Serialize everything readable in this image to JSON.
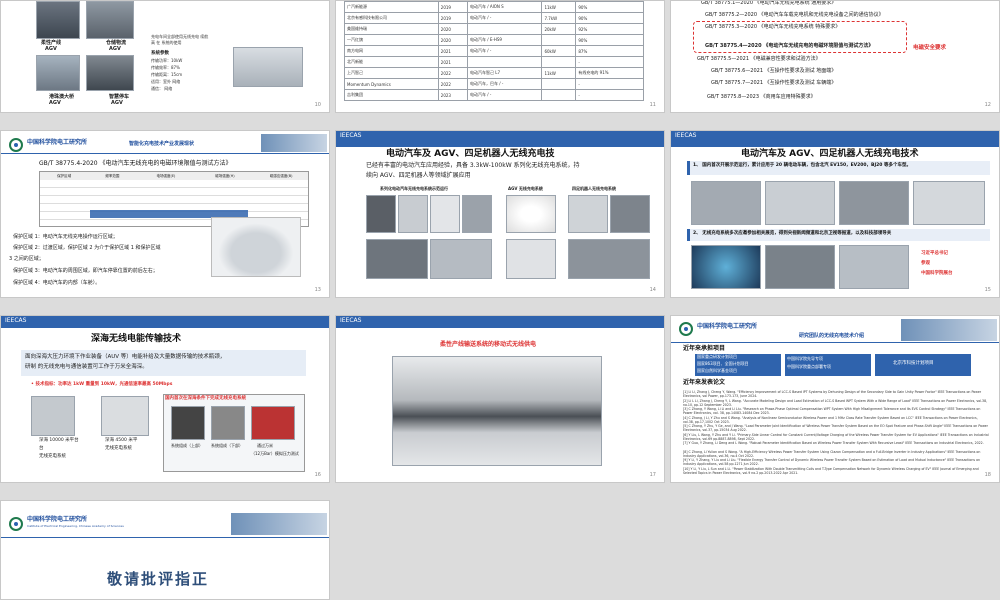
{
  "s1": {
    "label_a": "柔性产线",
    "label_a2": "AGV",
    "label_b": "仓储物流",
    "label_b2": "AGV",
    "label_c": "电动汽车",
    "label_d": "港珠澳大桥",
    "label_d2": "AGV",
    "label_e": "智慧停车",
    "label_e2": "AGV",
    "desc1": "充电车间全部使用无线充电  续航",
    "desc2": "高   在     系统的使用",
    "params_title": "系统参数",
    "p1": "传输功率：10kW",
    "p2": "传输效率：87%",
    "p3": "传输距离：15cm",
    "p4": "适用：室外   网络",
    "p5": "通信：   网络",
    "page": "10"
  },
  "s2": {
    "rows": [
      [
        "广汽新能源",
        "2019",
        "电动汽车 / AION S",
        "11kW",
        "90%"
      ],
      [
        "北京有感科技有限公司",
        "2019",
        "电动汽车 / -",
        "7.7kW",
        "90%"
      ],
      [
        "美国维持瑞",
        "2020",
        "",
        "20kW",
        "92%"
      ],
      [
        "一汽红旗",
        "2020",
        "电动汽车 / E-HS9",
        "",
        "90%"
      ],
      [
        "南方电网",
        "2021",
        "电动汽车 / -",
        "60kW",
        "87%"
      ],
      [
        "北汽新能",
        "2021",
        "",
        "",
        "-"
      ],
      [
        "上汽智己",
        "2022",
        "电动汽车智己 L7",
        "11kW",
        "有线充电的 91%"
      ],
      [
        "Momentum Dynamics",
        "2022",
        "电动汽车，巴车 / -",
        "",
        "-"
      ],
      [
        "吉利集团",
        "2023",
        "电动汽车 / -",
        "",
        "-"
      ]
    ],
    "page": "11"
  },
  "s3": {
    "lines": [
      "GB/T  38775.1—2020 《电动汽车无线充电系统 通用要求》",
      "GB/T  38775.2—2020 《电动汽车车载充电机和无线充电设备之间的通信协议》",
      "GB/T  38775.3—2020 《电动汽车无线充电系统 特殊要求》",
      "GB/T  38775.4—2020 《电动汽车无线充电的电磁环境限值与测试方法》",
      "GB/T  38775.5—2021 《电磁兼容性要求和试验方法》",
      "GB/T  38775.6—2021 《互操作性要求及测试 地面端》",
      "GB/T  38775.7—2021 《互操作性要求及测试 车辆端》",
      "GB/T  38775.8—2023 《商用车应用特殊要求》"
    ],
    "badge": "电磁安全要求",
    "page": "12"
  },
  "s4": {
    "org": "中国科学院电工研究所",
    "header": "智能化充电技术产业发展现状",
    "title": "GB/T  38775.4-2020 《电动汽车无线充电的电磁环境限值与测试方法》",
    "cols": [
      "保护区域",
      "频率范围",
      "电场强度(E)",
      "磁场强度(H)",
      "磁感应强度(B)"
    ],
    "z1": "保护区域 1：电动汽车无线充电操作运行区域；",
    "z2": "保护区域 2：过渡区域，保护区域 2 为介于保护区域 1 和保护区域",
    "z2b": "3 之间的区域；",
    "z3": "保护区域 3：电动汽车的周围区域，即汽车停靠位置的前后左右；",
    "z4": "保护区域 4：电动汽车的内部（车舱）。",
    "page": "13"
  },
  "s5": {
    "brand": "IEECAS",
    "title": "电动汽车及 AGV、四足机器人无线充电技",
    "intro1": "已经有丰富的电动汽车应用经验，具备 3.3kW-100kW 系列化无线充电系统，持",
    "intro2": "续向 AGV、四足机器人等领域扩展应用",
    "cap1": "系列化电动汽车无线充电系统示范运行",
    "cap2": "AGV 无线充电系统",
    "cap3": "四足机器人无线充电系统",
    "page": "14"
  },
  "s6": {
    "brand": "IEECAS",
    "title": "电动汽车及 AGV、四足机器人无线充电技术",
    "point1": "1、 国内首次开展示范运行，累计应用于 20 辆电动车辆，包含北汽 EV150，EV200，BJ20 等多个车型。",
    "point2": "2、 无线充电系统多次应邀参加相关展览，得到央视新闻频道和北京卫视等报道，以及科技部领导关",
    "side1": "习近平总书记",
    "side2": "参观",
    "side3": "中国科学院展台",
    "page": "15"
  },
  "s7": {
    "brand": "IEECAS",
    "title": "深海无线电能传输技术",
    "intro1": "面向深海大压力环境下作业装备（AUV 等）电能补给及大量数据传输的技术瓶颈，",
    "intro2": "研制 的无线充电与通信装置可工作于万米全海深。",
    "spec": "• 技术指标：功率达 1kW  重量到 10kW，光通信速率最高 50Mbps",
    "cap1": "深海 10000 米平台",
    "cap1b": "台",
    "cap2": "无线充电系统",
    "cap3": "深海 4500 米平",
    "cap4": "无线充电系统",
    "box": "国内首次在深海条件下完成无线充电系统",
    "cap5": "系统组成（上部）",
    "cap6": "系统组成（下部）",
    "cap7": "通过万米",
    "cap8": "（12万Bar）模拟压力测试",
    "page": "16"
  },
  "s8": {
    "brand": "IEECAS",
    "title": "柔性产线输送系统的移动式无线供电",
    "page": "17"
  },
  "s9": {
    "org": "中国科学院电工研究所",
    "header": "研究团队的无线充电技术介绍",
    "proj_title": "近年来承担项目",
    "proj": [
      "国家重点研发计划项目",
      "国家863项目、全国计划项目",
      "国家自然科学基金项目"
    ],
    "proj_r": [
      "中国科学院先导专项",
      "中国科学院重点部署专项"
    ],
    "proj_r2": "北京市科技计划项目",
    "pap_title": "近年来发表论文",
    "refs": [
      "[1] Li Li, Zhang J, Cheng Y, Wang. \"Efficiency Improvement of LCC-S Based IPT Systems by Dehuning Design of the Secondary Side to Gain Unity Power Factor\" IEEE Transactions on Power Electronics, vol  Power, pp.173-173, June 2024.",
      "[2] Li L Li, Zhang J, Cheng Y, L Wang. \"Accurate Modeling Design and Load Estimation of LCC-S Based WPT System With a Wide Range of Load\" IEEE Transactions on Power Electronics, vol.38, no.10, pp.12 September 2023.",
      "[3] C Zhang, Y Wang, Li Li and Li Liu. \"Research on Phase-Phase Optimal Compensation WPT System With High Misalignment Tolerance and Its EVS Control Strategy\" IEEE Transactions on Power Electronics, vol. 38, pp.14083-14084 Dec 2023.",
      "[4] C Zhang, J Li, Y Zhu and S Wang. \"Analysis of Nonlinear Semiconductor Wireless Power and 1 MHz Class Rate Transfer System Based on LCC\" IEEE Transactions on Power Electronics, vol.38, pp.17,1002 Oct 2023.",
      "[5] C Zhang, Y Zhu, Y Ge, and J Wang. \"Load Parameter Joint Identification of Wireless Power Transfer System Based on the EO Spot Feature and Phase-Shift Angle\" IEEE Transactions on Power Electronics, vol.37, pp.15034 Aug 2022.",
      "[6] Y Liu, L Wang, Y Zhu and Y Li. \"Primary-Side Linear Control for Constant Current/Voltage Charging of the Wireless Power Transfer System for EV Applications\" IEEE Transactions on Industrial Electronics, vol.69 pp.8887-8898, Sept 2022.",
      "[7] Y Guo, Y Zhang, Li Deng and L Wang. \"Robust Parameter Identification Based on Wireless Power Transfer System With Recursive Least\" IEEE Transactions on Industrial Electronics, 2022.",
      "[8] C Zhang, Li Yulian and S Wang. \"A High-Efficiency Wireless Power Transfer System Using Clazon Compensation and a Full-Bridge Inverter in Industry Applications\" IEEE Transactions on Industry Applications, vol.36, no.4 Oct 2022.",
      "[9] Y Li, Y Zhang, Y Liu and Li Liu. \"Flexible Energy Transfer Control of Dynamic Wireless Power Transfer System Based on Estimation of Load and Mutual Inductance\" IEEE Transactions on Industry Applications, vol.58 pp.1271 Jun 2022.",
      "[10] Y Li, Y Liu, L Sun and L Li. \"Power Stabilization With Double Transmitting Coils and T-Type Compensation Network for Dynamic Wireless Charging of EV\" IEEE Journal of Emerging and Selected Topics in Power Electronics, vol.9 no.2 pp.2013-2022 Apr 2021."
    ],
    "page": "18"
  },
  "s10": {
    "org": "中国科学院电工研究所",
    "org_en": "Institute of Electrical Engineering, Chinese Academy of Sciences",
    "closing": "敬请批评指正"
  }
}
